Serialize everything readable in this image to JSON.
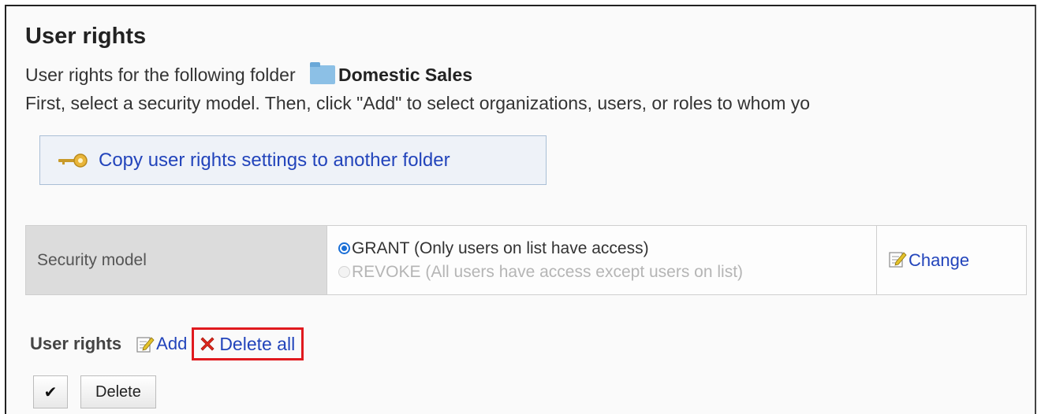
{
  "page": {
    "title": "User rights",
    "folder_intro": "User rights for the following folder",
    "folder_name": "Domestic Sales",
    "instructions": "First, select a security model. Then, click \"Add\" to select organizations, users, or roles to whom yo"
  },
  "copy_button": {
    "label": "Copy user rights settings to another folder"
  },
  "security_model": {
    "label": "Security model",
    "options": [
      {
        "label": "GRANT (Only users on list have access)",
        "selected": true
      },
      {
        "label": "REVOKE (All users have access except users on list)",
        "selected": false
      }
    ],
    "change_label": "Change"
  },
  "user_rights": {
    "label": "User rights",
    "add_label": "Add",
    "delete_all_label": "Delete all"
  },
  "buttons": {
    "check_glyph": "✔",
    "delete_label": "Delete"
  },
  "colors": {
    "link": "#2244bb",
    "highlight_box": "#e0191e",
    "radio_selected": "#1a6fd6"
  },
  "icons": [
    "folder-icon",
    "key-icon",
    "edit-icon",
    "delete-x-icon",
    "checkmark-icon"
  ]
}
